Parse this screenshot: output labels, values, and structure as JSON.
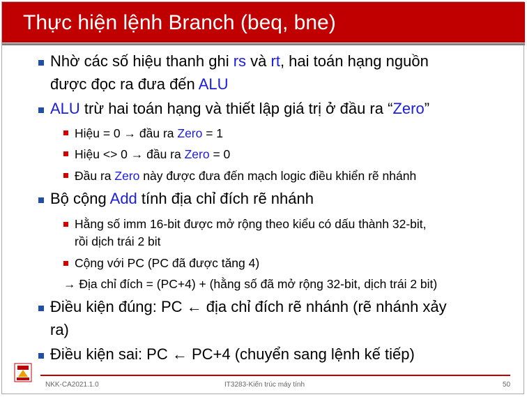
{
  "slide": {
    "title": "Thực hiện lệnh Branch (beq, bne)",
    "bullets": {
      "b1": {
        "t1": "Nhờ các số hiệu thanh ghi ",
        "rs": "rs",
        "t2": " và ",
        "rt": "rt",
        "t3": ", hai toán hạng nguồn",
        "t4": "được đọc ra đưa đến ",
        "alu": "ALU"
      },
      "b2": {
        "alu": "ALU",
        "t1": " trừ hai toán hạng và thiết lập giá trị ở đầu ra “",
        "zero": "Zero",
        "t2": "”"
      },
      "b2_1": {
        "t1": "Hiệu = 0   → đầu ra ",
        "zero": "Zero",
        "t2": " = 1"
      },
      "b2_2": {
        "t1": "Hiệu <> 0 → đầu ra ",
        "zero": "Zero",
        "t2": " = 0"
      },
      "b2_3": {
        "t1": "Đầu ra ",
        "zero": "Zero",
        "t2": " này được đưa đến mạch logic điều khiển rẽ nhánh"
      },
      "b3": {
        "t1": "Bộ cộng ",
        "add": "Add",
        "t2": " tính địa chỉ đích rẽ nhánh"
      },
      "b3_1": {
        "line1": "Hằng số imm 16-bit được mở rộng theo kiểu có dấu thành 32-bit,",
        "line2": "rồi dịch trái 2 bit"
      },
      "b3_2": "Cộng với PC (PC đã được tăng 4)",
      "b3_3": "→ Địa chỉ đích = (PC+4) + (hằng số đã mở rộng 32-bit, dịch trái 2 bit)",
      "b4": {
        "line1": "Điều kiện đúng: PC ← địa chỉ đích rẽ nhánh (rẽ nhánh xảy",
        "line2": "ra)"
      },
      "b5": "Điều kiện sai: PC ← PC+4 (chuyển sang lệnh kế tiếp)"
    },
    "footer": {
      "left": "NKK-CA2021.1.0",
      "center": "IT3283-Kiến trúc máy tính",
      "page": "50"
    },
    "colors": {
      "title_bg": "#c00000",
      "keyword": "#1c1cdc",
      "bullet_l1": "#1f4fa6",
      "bullet_l2": "#d40000"
    },
    "logo": {
      "icon": "university-logo-icon"
    }
  }
}
